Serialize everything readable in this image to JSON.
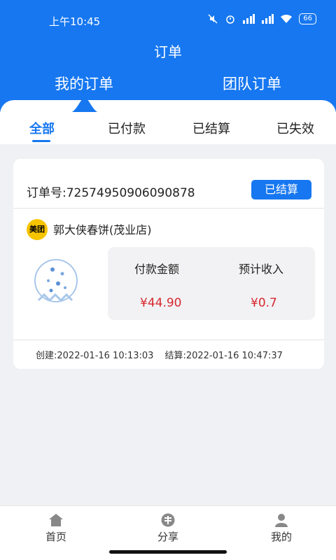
{
  "status_bar": {
    "time": "上午10:45",
    "battery": "66"
  },
  "header": {
    "title": "订单",
    "tabs": [
      {
        "label": "我的订单"
      },
      {
        "label": "团队订单"
      }
    ]
  },
  "filter_tabs": [
    {
      "label": "全部"
    },
    {
      "label": "已付款"
    },
    {
      "label": "已结算"
    },
    {
      "label": "已失效"
    }
  ],
  "order": {
    "number_label": "订单号:",
    "number": "72574950906090878",
    "status": "已结算",
    "platform_logo": "美团",
    "shop_name": "郭大侠春饼(茂业店)",
    "pay_label": "付款金额",
    "pay_value": "¥44.90",
    "income_label": "预计收入",
    "income_value": "¥0.7",
    "created": "创建:2022-01-16 10:13:03",
    "settled": "结算:2022-01-16 10:47:37"
  },
  "bottom_nav": [
    {
      "label": "首页",
      "icon": "home-icon"
    },
    {
      "label": "分享",
      "icon": "share-icon"
    },
    {
      "label": "我的",
      "icon": "user-icon"
    }
  ],
  "colors": {
    "accent": "#1677f0",
    "price": "#d7282f",
    "background": "#f0f1f4"
  }
}
